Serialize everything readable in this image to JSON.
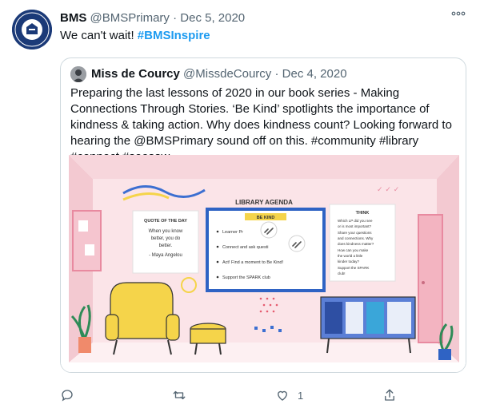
{
  "tweet": {
    "author_name": "BMS",
    "handle": "@BMSPrimary",
    "separator": " · ",
    "date": "Dec 5, 2020",
    "text": "We can't wait! ",
    "hashtag": "#BMSInspire",
    "more_icon": "more-icon"
  },
  "quote": {
    "author_name": "Miss de Courcy",
    "handle": "@MissdeCourcy",
    "separator": " · ",
    "date": "Dec 4, 2020",
    "text": "Preparing the last lessons of 2020 in our book series - Making Connections Through Stories. ‘Be Kind’ spotlights the importance of kindness & taking action. Why does kindness count? Looking forward to hearing the @BMSPrimary sound off on this. #community #library #connect #seesaw"
  },
  "image": {
    "agenda_title": "LIBRARY AGENDA",
    "be_kind": "BE KIND",
    "agenda_items": [
      "Learner Pr",
      "Connect and ask questi",
      "Act! Find a moment to Be Kind!",
      "Support the SPARK club"
    ],
    "quote_title": "QUOTE OF THE DAY",
    "quote_lines": [
      "When you know",
      "better, you do",
      "better."
    ],
    "quote_author": "- Maya Angelou",
    "think_title": "THINK",
    "think_items": [
      "Which LP did you see",
      "or is most important?",
      "Share your questions",
      "and connections. Why",
      "does kindness matter?",
      "How can you make",
      "the world a little",
      "kinder today?",
      "Support the SPARK",
      "club!"
    ],
    "colors": {
      "wall_pink": "#f7d6dc",
      "board_blue": "#2f63c4",
      "chair_yellow": "#f5d44a"
    }
  },
  "actions": {
    "reply_icon": "reply-icon",
    "retweet_icon": "retweet-icon",
    "like_icon": "like-icon",
    "like_count": "1",
    "share_icon": "share-icon"
  }
}
